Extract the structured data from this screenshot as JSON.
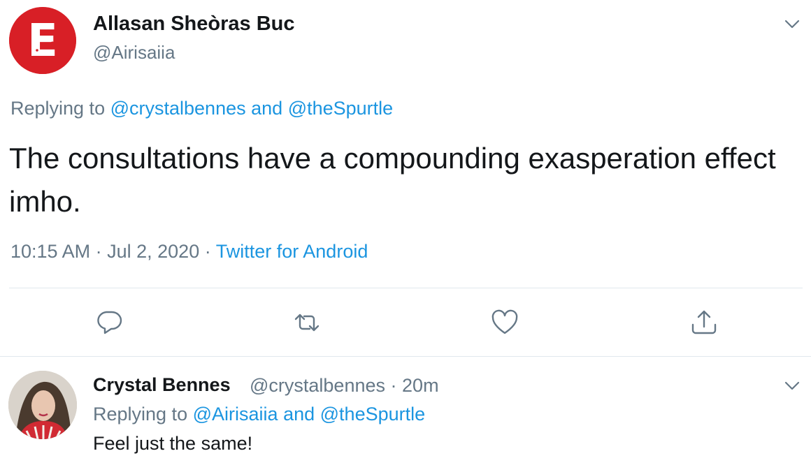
{
  "main_tweet": {
    "author_name": "Allasan Sheòras Buc",
    "author_handle": "@Airisaiia",
    "avatar_letter": "E",
    "replying_prefix": "Replying to",
    "replying_user_1": "@crystalbennes",
    "replying_and": "and",
    "replying_user_2": "@theSpurtle",
    "text": "The consultations have a compounding exasperation effect imho.",
    "time": "10:15 AM",
    "separator": "·",
    "date": "Jul 2, 2020",
    "source": "Twitter for Android"
  },
  "actions": {
    "reply_icon": "reply-icon",
    "retweet_icon": "retweet-icon",
    "like_icon": "heart-icon",
    "share_icon": "share-icon"
  },
  "reply_tweet": {
    "author_name": "Crystal Bennes",
    "author_handle": "@crystalbennes",
    "separator": "·",
    "time_ago": "20m",
    "replying_prefix": "Replying to",
    "replying_user_1": "@Airisaiia",
    "replying_and": "and",
    "replying_user_2": "@theSpurtle",
    "text": "Feel just the same!"
  },
  "colors": {
    "link_blue": "#1b95e0",
    "secondary_gray": "#657786",
    "avatar_red": "#d81f26",
    "divider": "#e1e8ed"
  }
}
